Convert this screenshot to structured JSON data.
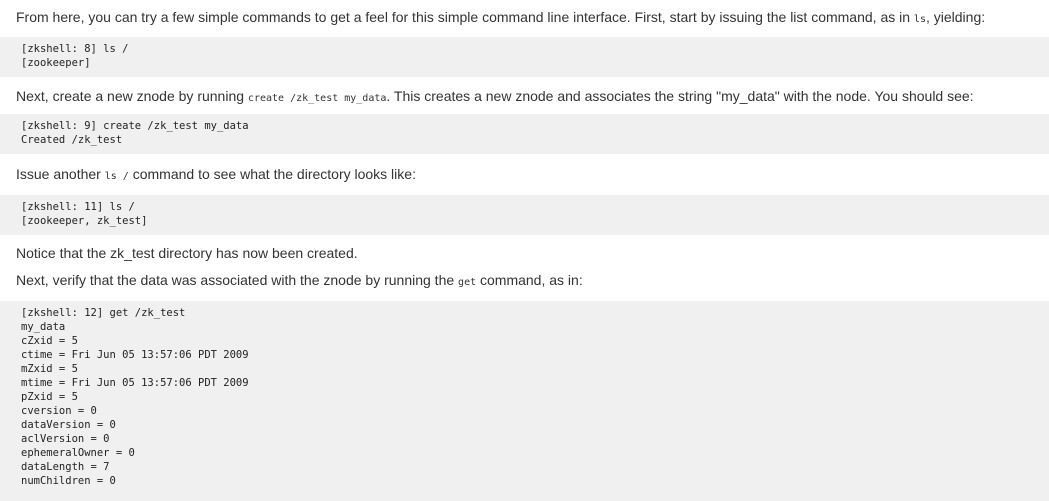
{
  "intro": {
    "text1": "From here, you can try a few simple commands to get a feel for this simple command line interface. First, start by issuing the list command, as in ",
    "code1": "ls",
    "text2": ", yielding:"
  },
  "block1": {
    "lines": [
      "[zkshell: 8] ls /",
      "[zookeeper]"
    ]
  },
  "create_para": {
    "text1": "Next, create a new znode by running ",
    "code1": "create /zk_test my_data",
    "text2": ". This creates a new znode and associates the string \"my_data\" with the node. You should see:"
  },
  "block2": {
    "lines": [
      "[zkshell: 9] create /zk_test my_data",
      "Created /zk_test"
    ]
  },
  "ls_para": {
    "text1": "Issue another ",
    "code1": "ls /",
    "text2": " command to see what the directory looks like:"
  },
  "block3": {
    "lines": [
      "[zkshell: 11] ls /",
      "[zookeeper, zk_test]"
    ]
  },
  "notice_para": {
    "text": "Notice that the zk_test directory has now been created."
  },
  "verify_para": {
    "text1": "Next, verify that the data was associated with the znode by running the ",
    "code1": "get",
    "text2": " command, as in:"
  },
  "block4": {
    "lines": [
      "[zkshell: 12] get /zk_test",
      "my_data",
      "cZxid = 5",
      "ctime = Fri Jun 05 13:57:06 PDT 2009",
      "mZxid = 5",
      "mtime = Fri Jun 05 13:57:06 PDT 2009",
      "pZxid = 5",
      "cversion = 0",
      "dataVersion = 0",
      "aclVersion = 0",
      "ephemeralOwner = 0",
      "dataLength = 7",
      "numChildren = 0"
    ]
  }
}
